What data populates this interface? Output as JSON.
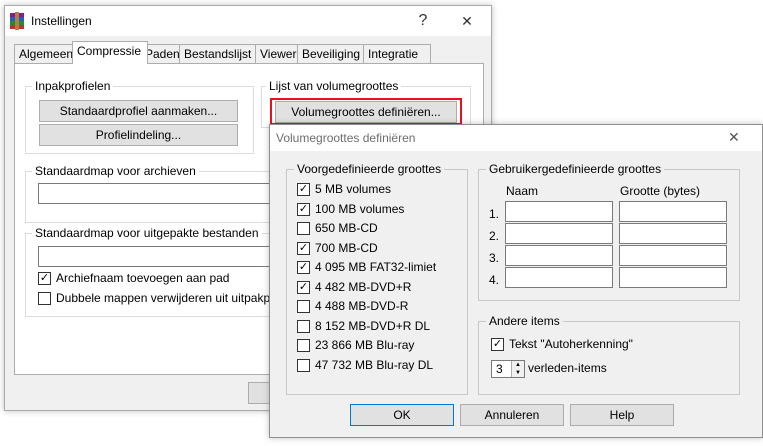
{
  "main_window": {
    "title": "Instellingen",
    "help_glyph": "?",
    "close_glyph": "✕",
    "tabs": [
      "Algemeen",
      "Compressie",
      "Paden",
      "Bestandslijst",
      "Viewer",
      "Beveiliging",
      "Integratie"
    ],
    "active_tab": "Compressie",
    "inpakprofielen": {
      "label": "Inpakprofielen",
      "create_default_button": "Standaardprofiel aanmaken...",
      "profile_layout_button": "Profielindeling..."
    },
    "volume_list": {
      "label": "Lijst van volumegroottes",
      "define_button": "Volumegroottes definiëren..."
    },
    "default_archive_folder": {
      "label": "Standaardmap voor archieven",
      "value": ""
    },
    "default_extract_folder": {
      "label": "Standaardmap voor uitgepakte bestanden",
      "value": "",
      "options": [
        {
          "label": "Archiefnaam toevoegen aan pad",
          "checked": true
        },
        {
          "label": "Dubbele mappen verwijderen uit uitpakpad",
          "checked": false
        }
      ]
    }
  },
  "dialog": {
    "title": "Volumegroottes definiëren",
    "close_glyph": "✕",
    "predefined": {
      "label": "Voorgedefinieerde groottes",
      "items": [
        {
          "label": "5 MB volumes",
          "checked": true
        },
        {
          "label": "100 MB volumes",
          "checked": true
        },
        {
          "label": "650 MB-CD",
          "checked": false
        },
        {
          "label": "700 MB-CD",
          "checked": true
        },
        {
          "label": "4 095 MB FAT32-limiet",
          "checked": true
        },
        {
          "label": "4 482 MB-DVD+R",
          "checked": true
        },
        {
          "label": "4 488 MB-DVD-R",
          "checked": false
        },
        {
          "label": "8 152 MB-DVD+R DL",
          "checked": false
        },
        {
          "label": "23 866 MB Blu-ray",
          "checked": false
        },
        {
          "label": "47 732 MB Blu-ray DL",
          "checked": false
        }
      ]
    },
    "user_defined": {
      "label": "Gebruikergedefinieerde groottes",
      "col_name": "Naam",
      "col_size": "Grootte (bytes)",
      "rows": [
        {
          "num": "1.",
          "name": "",
          "size": ""
        },
        {
          "num": "2.",
          "name": "",
          "size": ""
        },
        {
          "num": "3.",
          "name": "",
          "size": ""
        },
        {
          "num": "4.",
          "name": "",
          "size": ""
        }
      ]
    },
    "other_items": {
      "label": "Andere items",
      "autodetect_label": "Tekst \"Autoherkenning\"",
      "autodetect_checked": true,
      "previous_count": "3",
      "previous_label": "verleden-items"
    },
    "buttons": {
      "ok": "OK",
      "cancel": "Annuleren",
      "help": "Help"
    }
  },
  "colors": {
    "highlight_border": "#e81123",
    "window_bg": "#f0f0f0",
    "button_bg": "#e1e1e1"
  }
}
